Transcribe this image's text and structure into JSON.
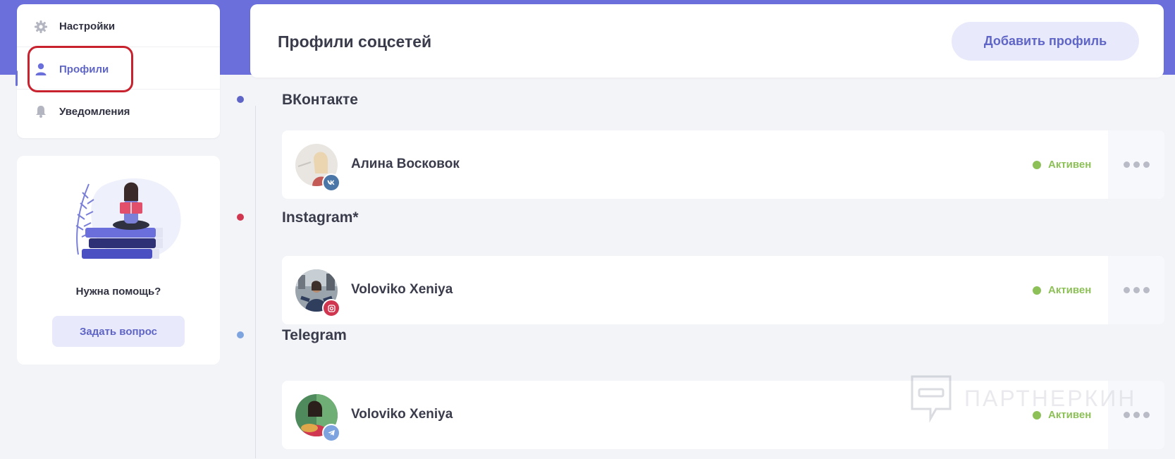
{
  "sidebar": {
    "items": [
      {
        "label": "Настройки",
        "icon": "gear-icon"
      },
      {
        "label": "Профили",
        "icon": "user-icon",
        "active": true
      },
      {
        "label": "Уведомления",
        "icon": "bell-icon"
      }
    ]
  },
  "help": {
    "title": "Нужна помощь?",
    "button_label": "Задать вопрос"
  },
  "header": {
    "title": "Профили соцсетей",
    "add_button_label": "Добавить профиль"
  },
  "sections": [
    {
      "title": "ВКонтакте",
      "dot_color": "#5f65c6",
      "profile": {
        "name": "Алина Восковок",
        "status": "Активен",
        "network_icon": "vk-icon"
      }
    },
    {
      "title": "Instagram*",
      "dot_color": "#d0364f",
      "profile": {
        "name": "Voloviko Xeniya",
        "status": "Активен",
        "network_icon": "instagram-icon"
      }
    },
    {
      "title": "Telegram",
      "dot_color": "#7ea4e0",
      "profile": {
        "name": "Voloviko Xeniya",
        "status": "Активен",
        "network_icon": "telegram-icon"
      }
    }
  ],
  "colors": {
    "accent": "#6a6fdc",
    "status_active": "#8dc158",
    "highlight": "#c8222e"
  },
  "watermark": {
    "text": "ПАРТНЕРКИН"
  }
}
